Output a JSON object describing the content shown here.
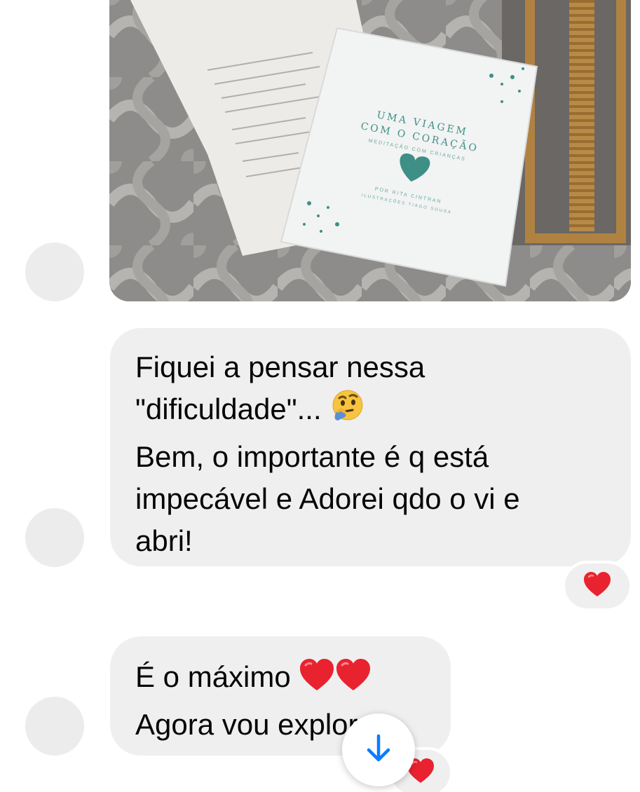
{
  "conversation": {
    "photo_message": {
      "book_title_line1": "UMA VIAGEM",
      "book_title_line2": "COM O CORAÇÃO",
      "book_subtitle": "MEDITAÇÃO COM CRIANÇAS",
      "book_author": "POR RITA CINTRAN",
      "book_illustrator": "ILUSTRAÇÕES TIAGO SOUSA"
    },
    "messages": [
      {
        "lines": [
          "Fiquei a pensar nessa",
          "\"dificuldade\"...",
          "Bem, o importante é q está",
          "impecável e Adorei qdo o vi e",
          "abri!"
        ],
        "emoji": "thinking-face-icon",
        "reaction": "red-heart-icon"
      },
      {
        "lines": [
          "É o máximo",
          "Agora vou explorar"
        ],
        "emoji": "two-red-hearts-icon",
        "reaction": "red-heart-icon"
      }
    ]
  },
  "scroll_button": {
    "icon": "arrow-down-icon",
    "color": "#0a7cff"
  },
  "colors": {
    "bubble": "#efeff0",
    "avatar": "#ececec",
    "heart": "#e8232f",
    "book_accent": "#3e8f86"
  }
}
